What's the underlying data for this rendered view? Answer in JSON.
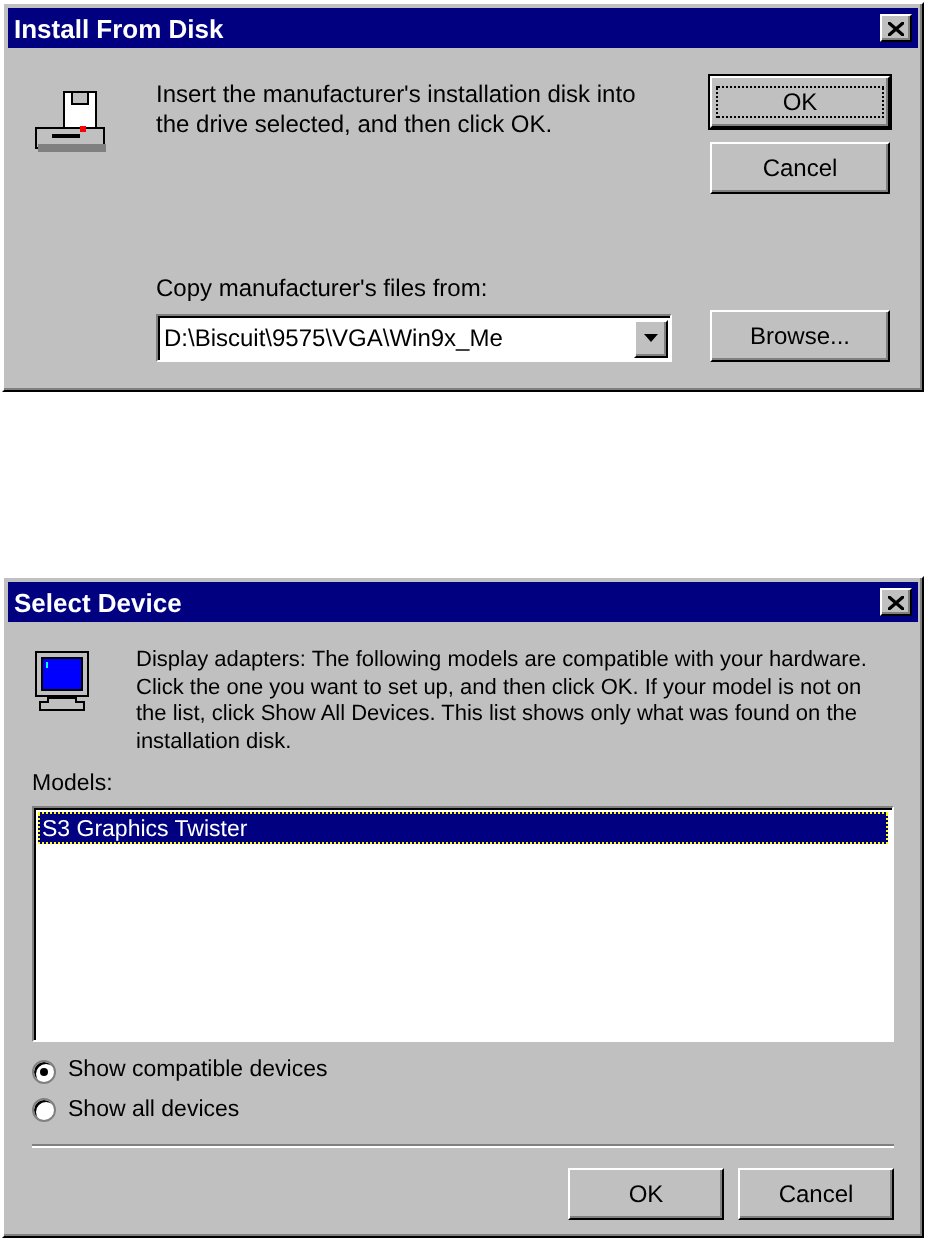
{
  "install_dialog": {
    "title": "Install From Disk",
    "message": "Insert the manufacturer's installation disk into the drive selected, and then click OK.",
    "buttons": [
      {
        "label": "OK",
        "default": true
      },
      {
        "label": "Cancel",
        "default": false
      }
    ],
    "copy_label": "Copy manufacturer's files from:",
    "path_value": "D:\\Biscuit\\9575\\VGA\\Win9x_Me",
    "browse_button": "Browse..."
  },
  "select_device_dialog": {
    "title": "Select Device",
    "message": "Display adapters: The following models are compatible with your hardware. Click the one you want to set up, and then click OK. If your model is not on the list, click Show All Devices. This list shows only what was found on the installation disk.",
    "models_label": "Models:",
    "models": [
      {
        "name": "S3 Graphics Twister",
        "selected": true
      }
    ],
    "options": [
      {
        "label": "Show compatible devices",
        "selected": true
      },
      {
        "label": "Show all devices",
        "selected": false
      }
    ],
    "buttons": [
      {
        "label": "OK",
        "default": false
      },
      {
        "label": "Cancel",
        "default": false
      }
    ]
  }
}
